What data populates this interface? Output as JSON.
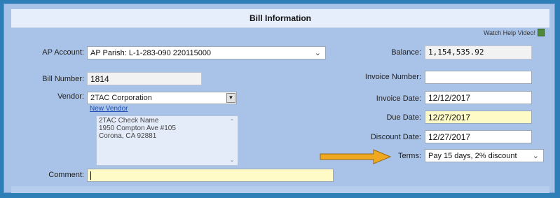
{
  "header": {
    "title": "Bill Information"
  },
  "help": {
    "label": "Watch Help Video!"
  },
  "ap_account": {
    "label": "AP Account:",
    "value": "AP Parish: L-1-283-090 220115000"
  },
  "bill_number": {
    "label": "Bill Number:",
    "value": "1814"
  },
  "vendor": {
    "label": "Vendor:",
    "value": "2TAC Corporation",
    "new_vendor_link": "New Vendor",
    "address_line1": "2TAC Check Name",
    "address_line2": "1950 Compton Ave #105",
    "address_line3": "Corona, CA 92881"
  },
  "comment": {
    "label": "Comment:",
    "value": ""
  },
  "balance": {
    "label": "Balance:",
    "value": "1,154,535.92"
  },
  "invoice_number": {
    "label": "Invoice Number:",
    "value": ""
  },
  "invoice_date": {
    "label": "Invoice Date:",
    "value": "12/12/2017"
  },
  "due_date": {
    "label": "Due Date:",
    "value": "12/27/2017"
  },
  "discount_date": {
    "label": "Discount Date:",
    "value": "12/27/2017"
  },
  "terms": {
    "label": "Terms:",
    "value": "Pay 15 days, 2% discount"
  },
  "colors": {
    "accent_arrow": "#f0a820",
    "highlight_field": "#fffbc6",
    "frame": "#2e7fb8"
  }
}
